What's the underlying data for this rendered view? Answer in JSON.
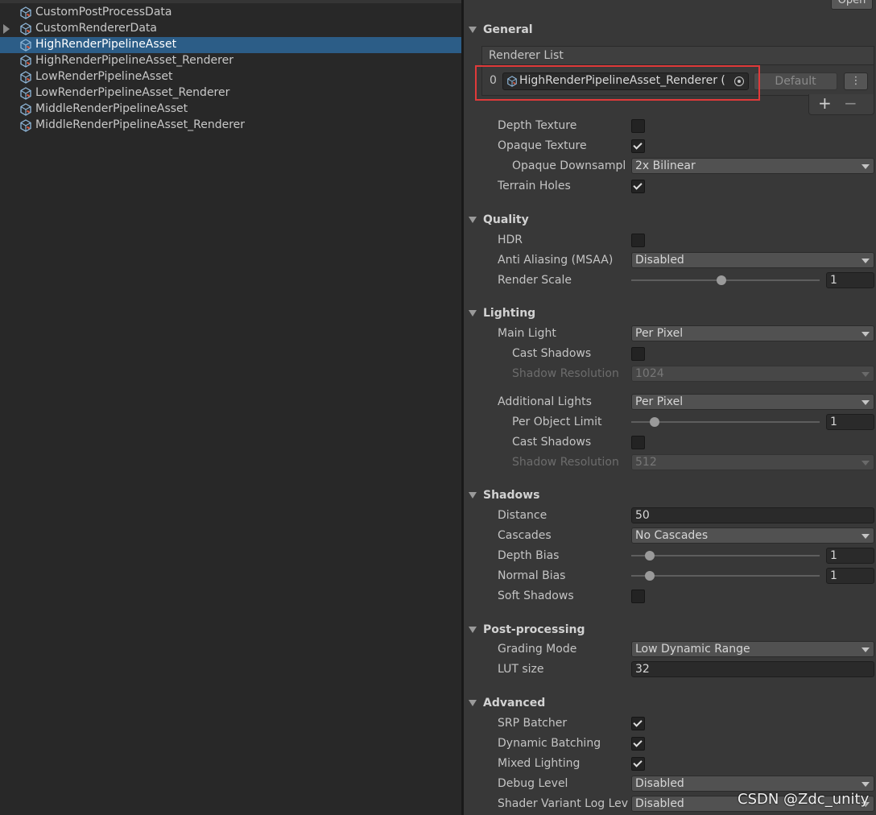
{
  "project": {
    "items": [
      {
        "label": "CustomPostProcessData",
        "selected": false,
        "expandable": false
      },
      {
        "label": "CustomRendererData",
        "selected": false,
        "expandable": true
      },
      {
        "label": "HighRenderPipelineAsset",
        "selected": true,
        "expandable": false
      },
      {
        "label": "HighRenderPipelineAsset_Renderer",
        "selected": false,
        "expandable": false
      },
      {
        "label": "LowRenderPipelineAsset",
        "selected": false,
        "expandable": false
      },
      {
        "label": "LowRenderPipelineAsset_Renderer",
        "selected": false,
        "expandable": false
      },
      {
        "label": "MiddleRenderPipelineAsset",
        "selected": false,
        "expandable": false
      },
      {
        "label": "MiddleRenderPipelineAsset_Renderer",
        "selected": false,
        "expandable": false
      }
    ],
    "icon": "scriptable-object-icon",
    "selection_color": "#2c5d87"
  },
  "inspector": {
    "open_button": "Open",
    "general": {
      "title": "General",
      "renderer_list": {
        "header": "Renderer List",
        "index": "0",
        "renderer": "HighRenderPipelineAsset_Renderer (",
        "default_button": "Default",
        "menu_glyph": "⋮",
        "plus": "+",
        "minus": "−",
        "highlight_color": "#e03a3a"
      },
      "depth_texture": {
        "label": "Depth Texture",
        "checked": false
      },
      "opaque_texture": {
        "label": "Opaque Texture",
        "checked": true
      },
      "opaque_downsampling": {
        "label": "Opaque Downsampl",
        "value": "2x Bilinear"
      },
      "terrain_holes": {
        "label": "Terrain Holes",
        "checked": true
      }
    },
    "quality": {
      "title": "Quality",
      "hdr": {
        "label": "HDR",
        "checked": false
      },
      "msaa": {
        "label": "Anti Aliasing (MSAA)",
        "value": "Disabled"
      },
      "render_scale": {
        "label": "Render Scale",
        "value": "1",
        "fraction": 0.48
      }
    },
    "lighting": {
      "title": "Lighting",
      "main_light": {
        "label": "Main Light",
        "value": "Per Pixel"
      },
      "main_cast_shadows": {
        "label": "Cast Shadows",
        "checked": false
      },
      "main_shadow_resolution": {
        "label": "Shadow Resolution",
        "value": "1024"
      },
      "additional_lights": {
        "label": "Additional Lights",
        "value": "Per Pixel"
      },
      "per_object_limit": {
        "label": "Per Object Limit",
        "value": "1",
        "fraction": 0.125
      },
      "add_cast_shadows": {
        "label": "Cast Shadows",
        "checked": false
      },
      "add_shadow_resolution": {
        "label": "Shadow Resolution",
        "value": "512"
      }
    },
    "shadows": {
      "title": "Shadows",
      "distance": {
        "label": "Distance",
        "value": "50"
      },
      "cascades": {
        "label": "Cascades",
        "value": "No Cascades"
      },
      "depth_bias": {
        "label": "Depth Bias",
        "value": "1",
        "fraction": 0.1
      },
      "normal_bias": {
        "label": "Normal Bias",
        "value": "1",
        "fraction": 0.1
      },
      "soft_shadows": {
        "label": "Soft Shadows",
        "checked": false
      }
    },
    "post_processing": {
      "title": "Post-processing",
      "grading_mode": {
        "label": "Grading Mode",
        "value": "Low Dynamic Range"
      },
      "lut_size": {
        "label": "LUT size",
        "value": "32"
      }
    },
    "advanced": {
      "title": "Advanced",
      "srp_batcher": {
        "label": "SRP Batcher",
        "checked": true
      },
      "dynamic_batching": {
        "label": "Dynamic Batching",
        "checked": true
      },
      "mixed_lighting": {
        "label": "Mixed Lighting",
        "checked": true
      },
      "debug_level": {
        "label": "Debug Level",
        "value": "Disabled"
      },
      "shader_variant_log": {
        "label": "Shader Variant Log Lev",
        "value": "Disabled"
      }
    }
  },
  "watermark": "CSDN @Zdc_unity"
}
